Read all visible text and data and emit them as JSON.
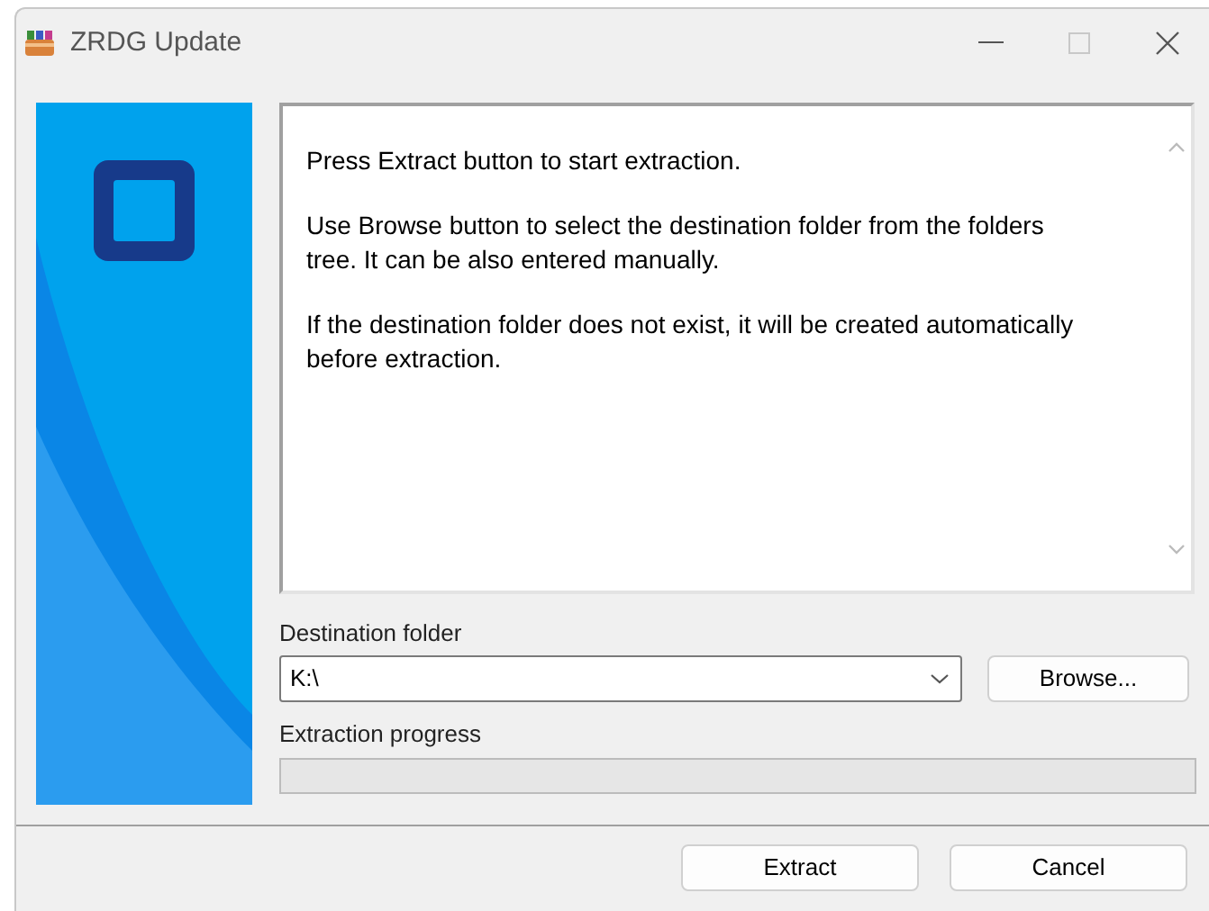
{
  "window": {
    "title": "ZRDG Update"
  },
  "message": [
    "Press Extract button to start extraction.",
    "Use Browse button to select the destination folder from the folders tree. It can be also entered manually.",
    "If the destination folder does not exist, it will be created automatically before extraction."
  ],
  "destination": {
    "label": "Destination folder",
    "value": "K:\\",
    "browse": "Browse..."
  },
  "progress": {
    "label": "Extraction progress",
    "level": 0
  },
  "buttons": [
    "Extract",
    "Cancel"
  ]
}
